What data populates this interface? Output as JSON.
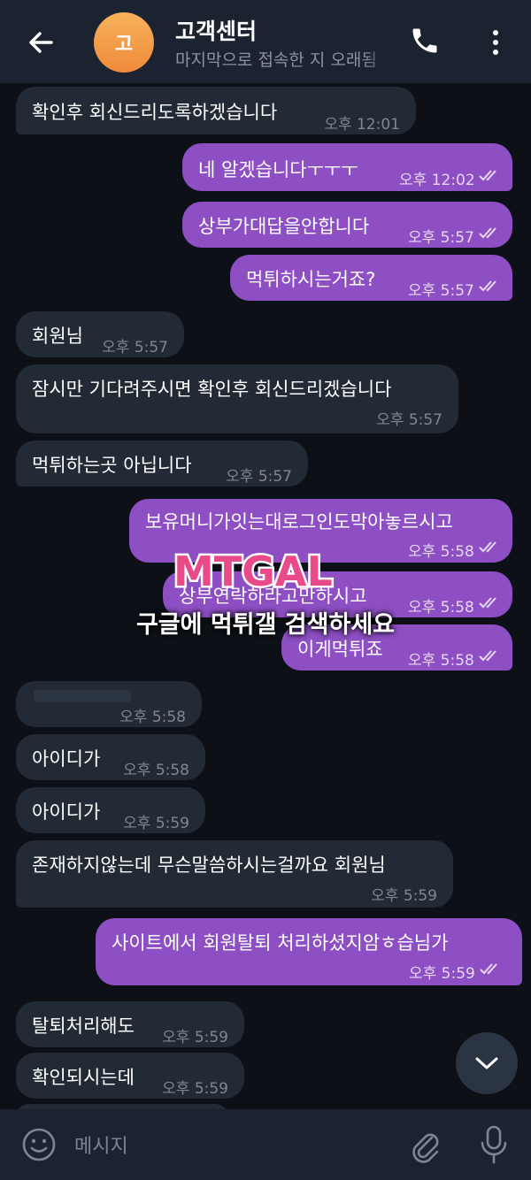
{
  "header": {
    "avatar_initial": "고",
    "title": "고객센터",
    "subtitle": "마지막으로 접속한 지 오래됨"
  },
  "messages": [
    {
      "dir": "in",
      "text": "확인후 회신드리도록하겠습니다",
      "time": "오후 12:01"
    },
    {
      "dir": "out",
      "text": "네 알겠습니다ㅜㅜㅜ",
      "time": "오후 12:02"
    },
    {
      "dir": "out",
      "text": "상부가대답을안합니다",
      "time": "오후 5:57"
    },
    {
      "dir": "out",
      "text": "먹튀하시는거죠?",
      "time": "오후 5:57"
    },
    {
      "dir": "in",
      "text": "회원님",
      "time": "오후 5:57"
    },
    {
      "dir": "in",
      "text": "잠시만 기다려주시면 확인후 회신드리겠습니다",
      "time": "오후 5:57"
    },
    {
      "dir": "in",
      "text": "먹튀하는곳 아닙니다",
      "time": "오후 5:57"
    },
    {
      "dir": "out",
      "text": "보유머니가잇는대로그인도막아놓르시고",
      "time": "오후 5:58"
    },
    {
      "dir": "out",
      "text": "상부연락하라고만하시고",
      "time": "오후 5:58"
    },
    {
      "dir": "out",
      "text": "이게먹튀죠",
      "time": "오후 5:58"
    },
    {
      "dir": "in",
      "text": "",
      "time": "오후 5:58"
    },
    {
      "dir": "in",
      "text": "아이디가",
      "time": "오후 5:58"
    },
    {
      "dir": "in",
      "text": "아이디가",
      "time": "오후 5:59"
    },
    {
      "dir": "in",
      "text": "존재하지않는데 무슨말씀하시는걸까요 회원님",
      "time": "오후 5:59"
    },
    {
      "dir": "out",
      "text": "사이트에서 회원탈퇴 처리하셨지암ㅎ습님가",
      "time": "오후 5:59"
    },
    {
      "dir": "in",
      "text": "탈퇴처리해도",
      "time": "오후 5:59"
    },
    {
      "dir": "in",
      "text": "확인되시는데",
      "time": "오후 5:59"
    }
  ],
  "watermark": {
    "logo": "MTGAL",
    "text": "구글에 먹튀갤 검색하세요"
  },
  "input": {
    "placeholder": "메시지"
  },
  "icons": {
    "back": "arrow-left-icon",
    "call": "phone-icon",
    "menu": "more-vertical-icon",
    "scroll": "chevron-down-icon",
    "emoji": "smiley-icon",
    "attach": "paperclip-icon",
    "voice": "microphone-icon",
    "read": "double-check-icon"
  },
  "colors": {
    "incoming_bubble": "#222a36",
    "outgoing_bubble": "#8e4fc4",
    "background": "#0d1117",
    "header": "#1c2330"
  }
}
